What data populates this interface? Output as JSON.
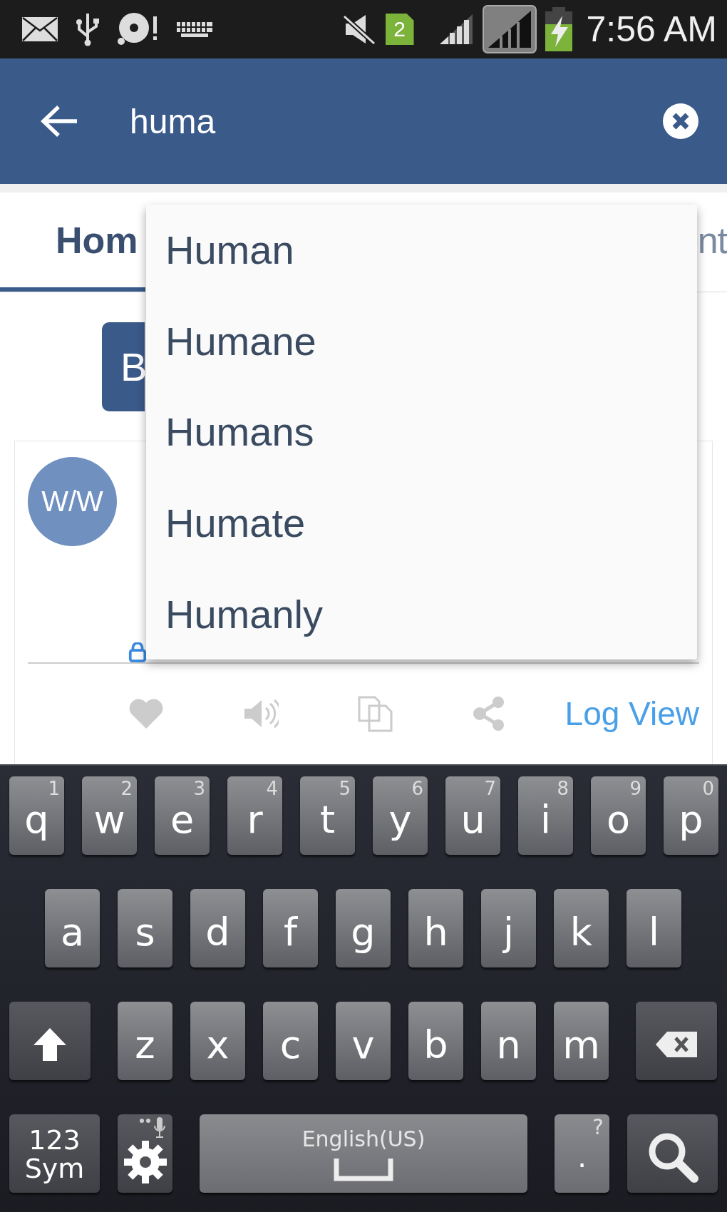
{
  "status_bar": {
    "sim_badge": "2",
    "time": "7:56 AM"
  },
  "search_bar": {
    "value": "huma"
  },
  "tabs": [
    {
      "label": "Hom",
      "selected": true
    },
    {
      "label": "nt",
      "selected": false
    }
  ],
  "action_button": {
    "label": "B"
  },
  "post": {
    "avatar": "W/W",
    "log_link": "Log View"
  },
  "suggestions": [
    "Human",
    "Humane",
    "Humans",
    "Humate",
    "Humanly"
  ],
  "keyboard": {
    "rows": [
      [
        {
          "kind": "letter",
          "label": "q",
          "hint": "1"
        },
        {
          "kind": "letter",
          "label": "w",
          "hint": "2"
        },
        {
          "kind": "letter",
          "label": "e",
          "hint": "3"
        },
        {
          "kind": "letter",
          "label": "r",
          "hint": "4"
        },
        {
          "kind": "letter",
          "label": "t",
          "hint": "5"
        },
        {
          "kind": "letter",
          "label": "y",
          "hint": "6"
        },
        {
          "kind": "letter",
          "label": "u",
          "hint": "7"
        },
        {
          "kind": "letter",
          "label": "i",
          "hint": "8"
        },
        {
          "kind": "letter",
          "label": "o",
          "hint": "9"
        },
        {
          "kind": "letter",
          "label": "p",
          "hint": "0"
        }
      ],
      [
        {
          "kind": "letter",
          "label": "a"
        },
        {
          "kind": "letter",
          "label": "s"
        },
        {
          "kind": "letter",
          "label": "d"
        },
        {
          "kind": "letter",
          "label": "f"
        },
        {
          "kind": "letter",
          "label": "g"
        },
        {
          "kind": "letter",
          "label": "h"
        },
        {
          "kind": "letter",
          "label": "j"
        },
        {
          "kind": "letter",
          "label": "k"
        },
        {
          "kind": "letter",
          "label": "l"
        }
      ],
      [
        {
          "kind": "shift"
        },
        {
          "kind": "letter",
          "label": "z"
        },
        {
          "kind": "letter",
          "label": "x"
        },
        {
          "kind": "letter",
          "label": "c"
        },
        {
          "kind": "letter",
          "label": "v"
        },
        {
          "kind": "letter",
          "label": "b"
        },
        {
          "kind": "letter",
          "label": "n"
        },
        {
          "kind": "letter",
          "label": "m"
        },
        {
          "kind": "delete"
        }
      ]
    ],
    "bottom_row": {
      "symbols_key": "123 Sym",
      "space_key": "English(US)",
      "period_key": ".",
      "period_hint": "?"
    }
  }
}
